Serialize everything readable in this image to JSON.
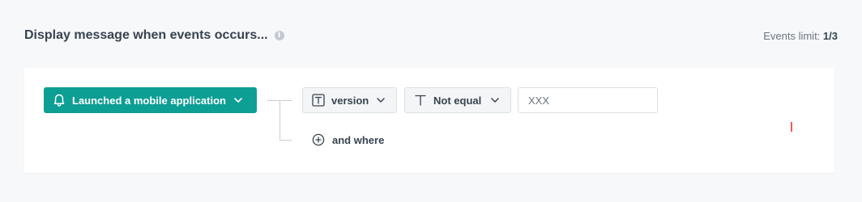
{
  "header": {
    "title": "Display message when events occurs...",
    "info_icon": "info-icon",
    "limit_label": "Events limit:",
    "limit_value": "1/3"
  },
  "rule": {
    "event": {
      "label": "Launched a mobile application",
      "icon": "bell-icon"
    },
    "parameter": {
      "label": "version",
      "icon": "text-type-icon"
    },
    "operator": {
      "label": "Not equal",
      "icon": "text-t-icon"
    },
    "value_input": {
      "value": "XXX",
      "placeholder": ""
    },
    "add_condition": {
      "label": "and where",
      "icon": "plus-circle-icon"
    }
  },
  "colors": {
    "accent": "#0d9e94",
    "text": "#384350",
    "muted": "#6a7580",
    "background": "#f7f8fa",
    "border": "#dbe0e5"
  }
}
